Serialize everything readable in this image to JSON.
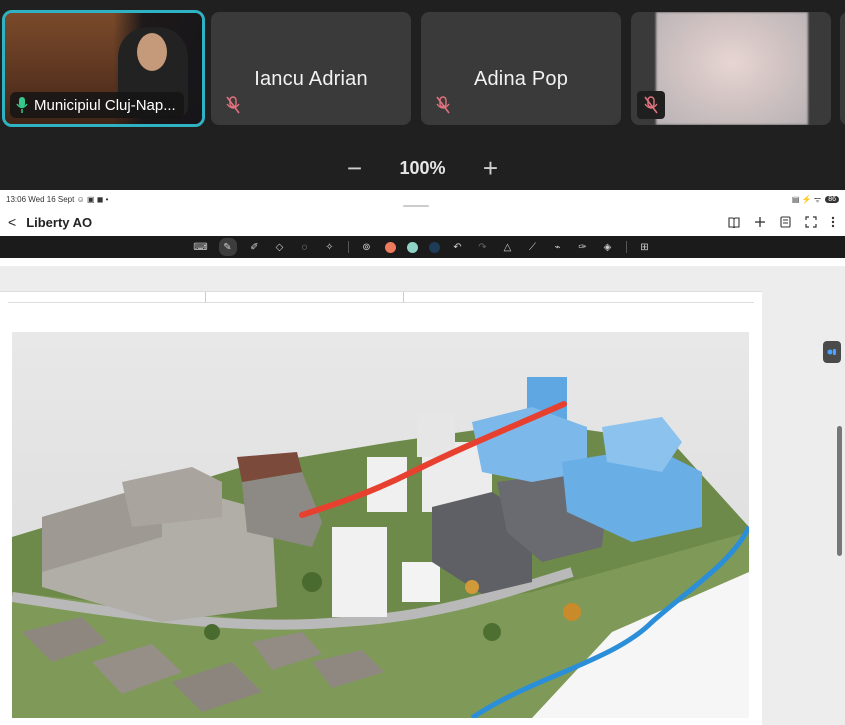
{
  "participants": [
    {
      "name": "Municipiul Cluj-Nap...",
      "speaking": true
    },
    {
      "name": "Iancu Adrian",
      "muted": true
    },
    {
      "name": "Adina Pop",
      "muted": true
    },
    {
      "name": "",
      "muted": true,
      "video": "blurred"
    }
  ],
  "zoom": {
    "minus": "−",
    "value": "100%",
    "plus": "+"
  },
  "tablet": {
    "status_left": "13:06  Wed 16 Sept  ☺ ▣ ◼ •",
    "status_right": "▤ ⚡ ᯤ",
    "battery": "86",
    "doc_title": "Liberty AO",
    "back": "<",
    "actions": [
      "book-icon",
      "plus-icon",
      "document-icon",
      "fullscreen-icon",
      "more-icon"
    ],
    "toolbar_colors": [
      "#ee7a5e",
      "#8fd3c7",
      "#1e3b57"
    ],
    "pen_color": "#e8402e"
  }
}
